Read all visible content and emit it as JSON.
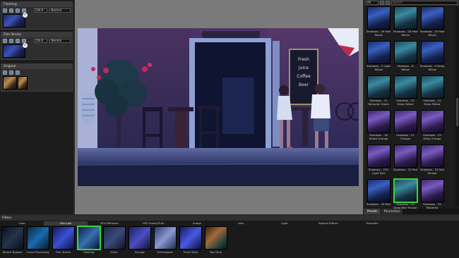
{
  "layers": [
    {
      "title": "Flashing",
      "value": "100.0",
      "mode": "Normal",
      "thumb": "blue",
      "checked": true
    },
    {
      "title": "Film Stocks",
      "value": "100.0",
      "mode": "Normal",
      "thumb": "blue",
      "checked": true
    },
    {
      "title": "Original",
      "value": "",
      "mode": "",
      "thumb": "orig",
      "checked": false
    }
  ],
  "right_panel": {
    "category_select": "All",
    "search_placeholder": "Search",
    "presets": [
      {
        "label": "Shadows - 26 Pale Yellow",
        "tone": "blue",
        "selected": false
      },
      {
        "label": "Shadows - 28 Pale Yellow",
        "tone": "teal",
        "selected": false
      },
      {
        "label": "Shadows - 29 Pale Yellow",
        "tone": "blue",
        "selected": false
      },
      {
        "label": "Shadows - 2 Light Yellow",
        "tone": "blue",
        "selected": false
      },
      {
        "label": "Shadows - 8 Yellow",
        "tone": "teal",
        "selected": false
      },
      {
        "label": "Shadows - 9 Deep Yellow",
        "tone": "blue",
        "selected": false
      },
      {
        "label": "Shadows - 21 Yellowish Green",
        "tone": "teal",
        "selected": false
      },
      {
        "label": "Shadows - 22 Deep Yellow",
        "tone": "teal",
        "selected": false
      },
      {
        "label": "Shadows - 22 Deep Yellow",
        "tone": "teal",
        "selected": false
      },
      {
        "label": "Shadows - 18 Yellow Orange",
        "tone": "purple",
        "selected": false
      },
      {
        "label": "Shadows - 21 Orange",
        "tone": "purple",
        "selected": false
      },
      {
        "label": "Shadows - 22 Deep Orange",
        "tone": "purple",
        "selected": false
      },
      {
        "label": "Shadows - 23H Light Red",
        "tone": "purple",
        "selected": false
      },
      {
        "label": "Shadows - 24 Red",
        "tone": "purple",
        "selected": false
      },
      {
        "label": "Shadows - 25 Red Tricolor",
        "tone": "purple",
        "selected": false
      },
      {
        "label": "Shadows - 26 Red",
        "tone": "blue",
        "selected": false
      },
      {
        "label": "Shadows - 29 Deep Red Tricolor",
        "tone": "teal",
        "selected": true
      },
      {
        "label": "Shadows - 32 Magenta",
        "tone": "purple",
        "selected": false
      }
    ],
    "tabs": [
      {
        "label": "Presets",
        "active": true
      },
      {
        "label": "Parameters",
        "active": false
      }
    ]
  },
  "bottom": {
    "header": "Filters",
    "categories": [
      {
        "label": "Color",
        "active": false
      },
      {
        "label": "Film Lab",
        "active": true
      },
      {
        "label": "HFX Diffusion",
        "active": false
      },
      {
        "label": "HFX Grads/Tints",
        "active": false
      },
      {
        "label": "Image",
        "active": false
      },
      {
        "label": "Lens",
        "active": false
      },
      {
        "label": "Light",
        "active": false
      },
      {
        "label": "Special Effects",
        "active": false
      },
      {
        "label": "Favorites",
        "active": false
      }
    ],
    "filters": [
      {
        "label": "Bleach Bypass",
        "selected": false
      },
      {
        "label": "Cross Processing",
        "selected": false
      },
      {
        "label": "Film Stocks",
        "selected": false
      },
      {
        "label": "Flashing",
        "selected": true
      },
      {
        "label": "Grain",
        "selected": false
      },
      {
        "label": "Grunge",
        "selected": false
      },
      {
        "label": "Overexpose",
        "selected": false
      },
      {
        "label": "Three Strip",
        "selected": false
      },
      {
        "label": "Two Strip",
        "selected": false
      }
    ]
  },
  "photo": {
    "chalkboard_lines": [
      "Fresh",
      "Juice",
      "Coffee",
      "Beer"
    ]
  },
  "colors": {
    "selection_green": "#3cd23c",
    "panel_bg": "#1c1c1c",
    "canvas_bg": "#7a7a7a"
  }
}
